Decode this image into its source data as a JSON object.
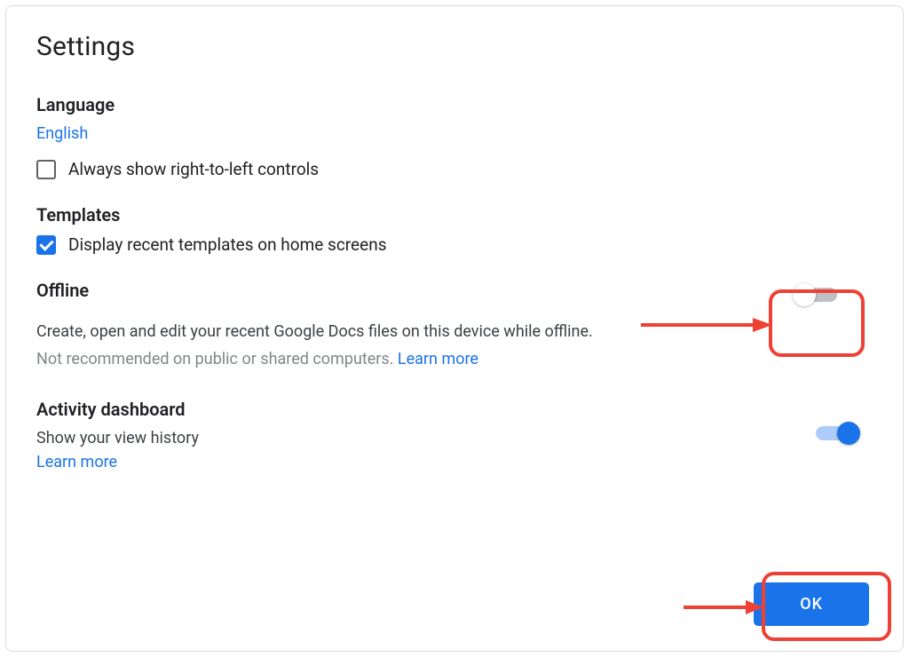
{
  "dialog": {
    "title": "Settings"
  },
  "language": {
    "heading": "Language",
    "current": "English",
    "rtl_label": "Always show right-to-left controls",
    "rtl_checked": false
  },
  "templates": {
    "heading": "Templates",
    "display_label": "Display recent templates on home screens",
    "display_checked": true
  },
  "offline": {
    "heading": "Offline",
    "description": "Create, open and edit your recent Google Docs files on this device while offline.",
    "hint_prefix": "Not recommended on public or shared computers. ",
    "learn_more": "Learn more",
    "enabled": false
  },
  "activity": {
    "heading": "Activity dashboard",
    "description": "Show your view history",
    "learn_more": "Learn more",
    "enabled": true
  },
  "buttons": {
    "ok": "OK"
  }
}
